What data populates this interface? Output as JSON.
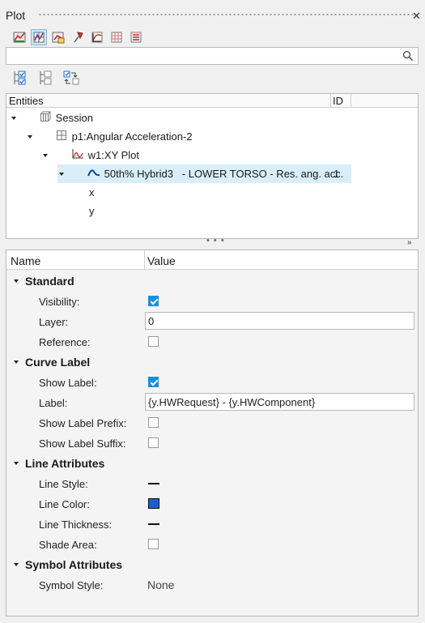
{
  "panel": {
    "title": "Plot"
  },
  "search": {
    "value": "",
    "placeholder": ""
  },
  "tree": {
    "headers": {
      "entities": "Entities",
      "id": "ID"
    },
    "nodes": [
      {
        "label": "Session",
        "icon": "session-icon"
      },
      {
        "label": "p1:Angular Acceleration-2",
        "icon": "page-icon"
      },
      {
        "label": "w1:XY Plot",
        "icon": "xy-plot-icon"
      },
      {
        "label": "50th% Hybrid3   - LOWER TORSO - Res. ang. acc.",
        "id": "1",
        "icon": "curve-icon",
        "selected": true
      },
      {
        "label": "x"
      },
      {
        "label": "y"
      }
    ]
  },
  "properties": {
    "headers": {
      "name": "Name",
      "value": "Value"
    },
    "sections": {
      "standard": {
        "title": "Standard",
        "visibility": {
          "label": "Visibility:",
          "checked": true
        },
        "layer": {
          "label": "Layer:",
          "value": "0"
        },
        "reference": {
          "label": "Reference:",
          "checked": false
        }
      },
      "curve_label": {
        "title": "Curve Label",
        "show_label": {
          "label": "Show Label:",
          "checked": true
        },
        "label": {
          "label": "Label:",
          "value": "{y.HWRequest} - {y.HWComponent}"
        },
        "show_prefix": {
          "label": "Show Label Prefix:",
          "checked": false
        },
        "show_suffix": {
          "label": "Show Label Suffix:",
          "checked": false
        }
      },
      "line_attributes": {
        "title": "Line Attributes",
        "line_style": {
          "label": "Line Style:"
        },
        "line_color": {
          "label": "Line Color:",
          "color": "#1f5bd6"
        },
        "line_thickness": {
          "label": "Line Thickness:"
        },
        "shade_area": {
          "label": "Shade Area:",
          "checked": false
        }
      },
      "symbol_attributes": {
        "title": "Symbol Attributes",
        "symbol_style": {
          "label": "Symbol Style:",
          "value": "None"
        }
      }
    }
  }
}
